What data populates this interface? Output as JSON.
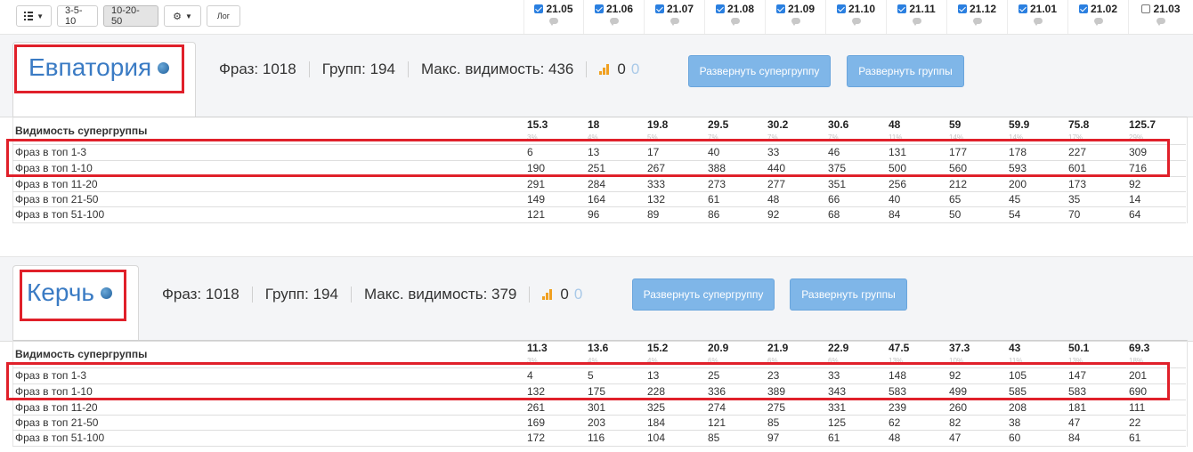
{
  "toolbar": {
    "btn_35": "3-5-10",
    "btn_1020": "10-20-50",
    "btn_log": "Лог"
  },
  "dates": [
    {
      "label": "21.05",
      "checked": true
    },
    {
      "label": "21.06",
      "checked": true
    },
    {
      "label": "21.07",
      "checked": true
    },
    {
      "label": "21.08",
      "checked": true
    },
    {
      "label": "21.09",
      "checked": true
    },
    {
      "label": "21.10",
      "checked": true
    },
    {
      "label": "21.11",
      "checked": true
    },
    {
      "label": "21.12",
      "checked": true
    },
    {
      "label": "21.01",
      "checked": true
    },
    {
      "label": "21.02",
      "checked": true
    },
    {
      "label": "21.03",
      "checked": false
    }
  ],
  "sections": [
    {
      "city": "Евпатория",
      "phrases": "Фраз: 1018",
      "groups": "Групп: 194",
      "max_visibility": "Макс. видимость: 436",
      "zero_a": "0",
      "zero_b": "0",
      "btn_supergroup": "Развернуть супергруппу",
      "btn_groups": "Развернуть группы",
      "header_label": "Видимость супергруппы",
      "header_values": [
        "15.3",
        "18",
        "19.8",
        "29.5",
        "30.2",
        "30.6",
        "48",
        "59",
        "59.9",
        "75.8",
        "125.7"
      ],
      "header_pcts": [
        "3%",
        "4%",
        "5%",
        "7%",
        "7%",
        "7%",
        "11%",
        "14%",
        "14%",
        "17%",
        "29%"
      ],
      "rows": [
        {
          "label": "Фраз в топ 1-3",
          "values": [
            "6",
            "13",
            "17",
            "40",
            "33",
            "46",
            "131",
            "177",
            "178",
            "227",
            "309"
          ]
        },
        {
          "label": "Фраз в топ 1-10",
          "values": [
            "190",
            "251",
            "267",
            "388",
            "440",
            "375",
            "500",
            "560",
            "593",
            "601",
            "716"
          ]
        },
        {
          "label": "Фраз в топ 11-20",
          "values": [
            "291",
            "284",
            "333",
            "273",
            "277",
            "351",
            "256",
            "212",
            "200",
            "173",
            "92"
          ]
        },
        {
          "label": "Фраз в топ 21-50",
          "values": [
            "149",
            "164",
            "132",
            "61",
            "48",
            "66",
            "40",
            "65",
            "45",
            "35",
            "14"
          ]
        },
        {
          "label": "Фраз в топ 51-100",
          "values": [
            "121",
            "96",
            "89",
            "86",
            "92",
            "68",
            "84",
            "50",
            "54",
            "70",
            "64"
          ]
        }
      ]
    },
    {
      "city": "Керчь",
      "phrases": "Фраз: 1018",
      "groups": "Групп: 194",
      "max_visibility": "Макс. видимость: 379",
      "zero_a": "0",
      "zero_b": "0",
      "btn_supergroup": "Развернуть супергруппу",
      "btn_groups": "Развернуть группы",
      "header_label": "Видимость супергруппы",
      "header_values": [
        "11.3",
        "13.6",
        "15.2",
        "20.9",
        "21.9",
        "22.9",
        "47.5",
        "37.3",
        "43",
        "50.1",
        "69.3"
      ],
      "header_pcts": [
        "3%",
        "4%",
        "4%",
        "6%",
        "6%",
        "6%",
        "13%",
        "10%",
        "11%",
        "13%",
        "18%"
      ],
      "rows": [
        {
          "label": "Фраз в топ 1-3",
          "values": [
            "4",
            "5",
            "13",
            "25",
            "23",
            "33",
            "148",
            "92",
            "105",
            "147",
            "201"
          ]
        },
        {
          "label": "Фраз в топ 1-10",
          "values": [
            "132",
            "175",
            "228",
            "336",
            "389",
            "343",
            "583",
            "499",
            "585",
            "583",
            "690"
          ]
        },
        {
          "label": "Фраз в топ 11-20",
          "values": [
            "261",
            "301",
            "325",
            "274",
            "275",
            "331",
            "239",
            "260",
            "208",
            "181",
            "111"
          ]
        },
        {
          "label": "Фраз в топ 21-50",
          "values": [
            "169",
            "203",
            "184",
            "121",
            "85",
            "125",
            "62",
            "82",
            "38",
            "47",
            "22"
          ]
        },
        {
          "label": "Фраз в топ 51-100",
          "values": [
            "172",
            "116",
            "104",
            "85",
            "97",
            "61",
            "48",
            "47",
            "60",
            "84",
            "61"
          ]
        }
      ]
    }
  ]
}
